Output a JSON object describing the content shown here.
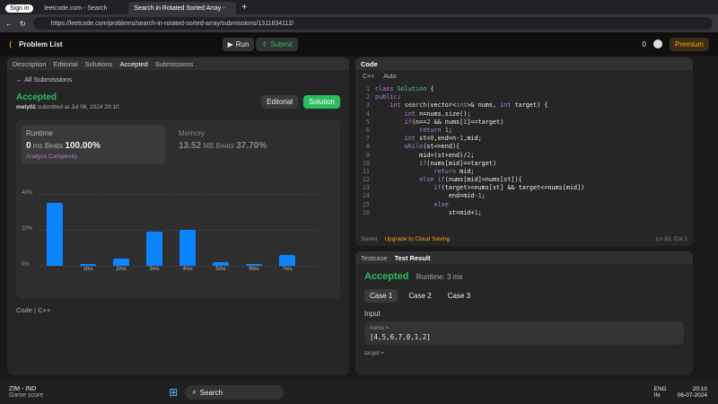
{
  "browser": {
    "tab1": "Sign in",
    "tab2": "leetcode.com - Search",
    "tab3": "Search in Rotated Sorted Array -",
    "url": "https://leetcode.com/problems/search-in-rotated-sorted-array/submissions/1311634112/"
  },
  "lc": {
    "problem_list": "Problem List",
    "run": "Run",
    "submit": "Submit",
    "premium": "Premium",
    "fire": "0"
  },
  "left": {
    "tabs": [
      "Description",
      "Editorial",
      "Solutions",
      "Accepted",
      "Submissions"
    ],
    "all_subs": "All Submissions",
    "status": "Accepted",
    "user": "mely02",
    "submitted": "submitted at Jul 06, 2024 20:10",
    "editorial_btn": "Editorial",
    "solution_btn": "Solution",
    "runtime_label": "Runtime",
    "runtime_val": "0",
    "runtime_unit": "ms",
    "beats_label": "Beats",
    "runtime_beats": "100.00%",
    "analyze": "Analyze Complexity",
    "memory_label": "Memory",
    "memory_val": "13.52",
    "memory_unit": "MB",
    "memory_beats": "37.70%",
    "code_label": "Code",
    "lang": "C++"
  },
  "chart_data": {
    "type": "bar",
    "categories": [
      "",
      "1ms",
      "2ms",
      "3ms",
      "4ms",
      "5ms",
      "6ms",
      "7ms"
    ],
    "values": [
      35,
      1,
      4,
      19,
      20,
      2,
      1,
      6
    ],
    "ylim": [
      0,
      40
    ],
    "yticks": [
      "40%",
      "20%",
      "0%"
    ]
  },
  "code": {
    "title": "Code",
    "lang": "C++",
    "auto": "Auto",
    "saved": "Saved",
    "upgrade": "Upgrade to Cloud Saving",
    "pos": "Ln 33, Col 1"
  },
  "result": {
    "testcase": "Testcase",
    "test_result": "Test Result",
    "accepted": "Accepted",
    "runtime": "Runtime: 3 ms",
    "cases": [
      "Case 1",
      "Case 2",
      "Case 3"
    ],
    "input": "Input",
    "nums_label": "nums =",
    "nums_val": "[4,5,6,7,0,1,2]",
    "target_label": "target ="
  },
  "taskbar": {
    "weather": "ZIM - IND",
    "weather_sub": "Game score",
    "search": "Search",
    "lang1": "ENG",
    "lang2": "IN",
    "time": "20:10",
    "date": "06-07-2024"
  }
}
